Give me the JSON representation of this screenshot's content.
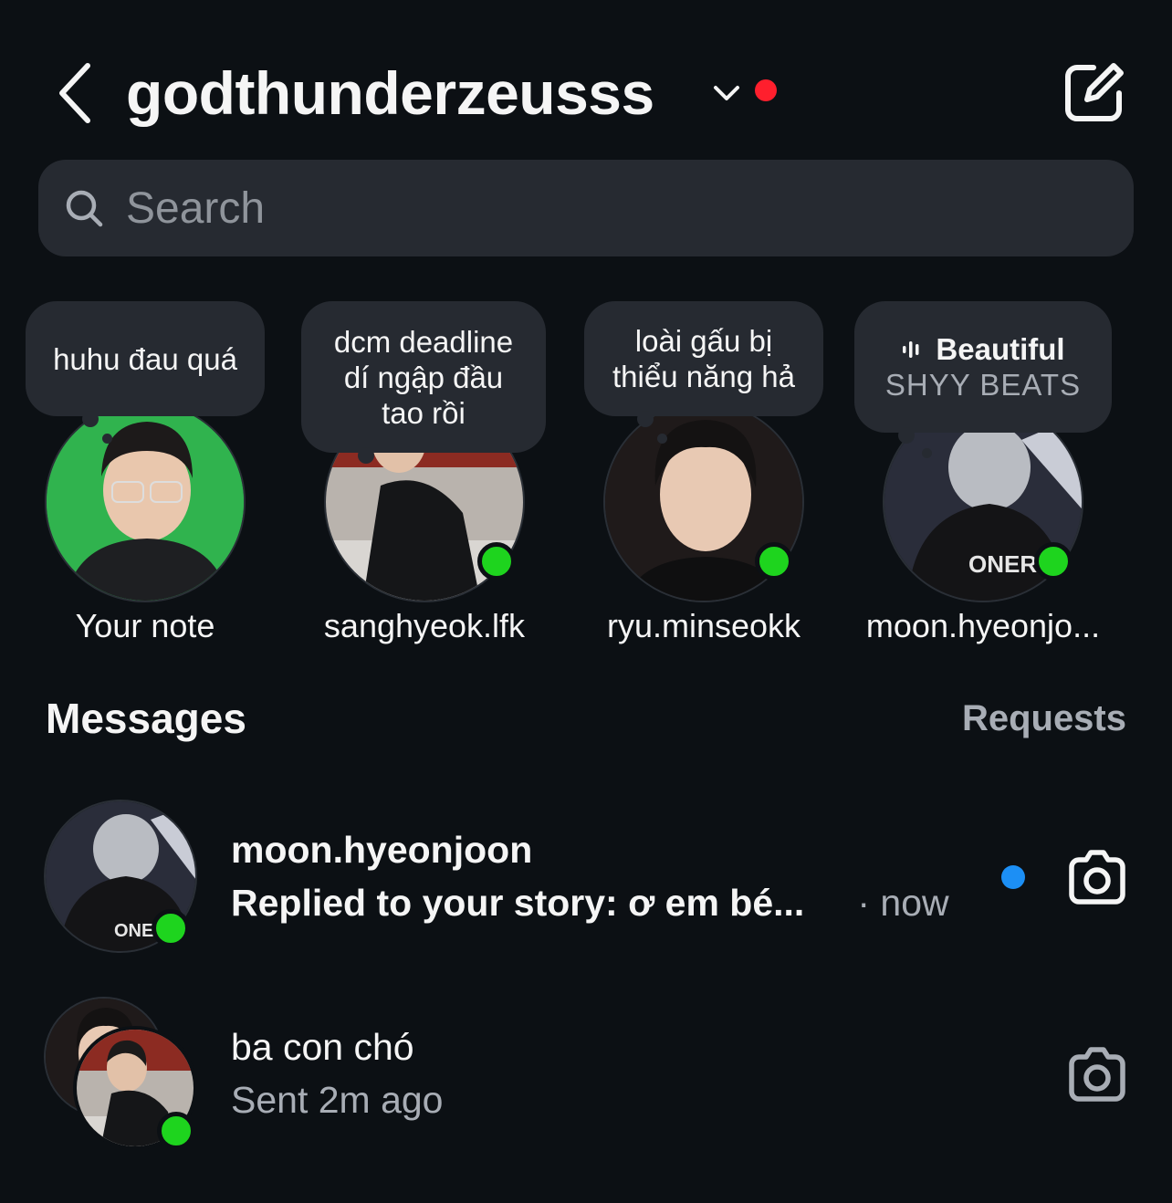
{
  "header": {
    "account_name": "godthunderzeusss",
    "has_unread_indicator": true
  },
  "search": {
    "placeholder": "Search"
  },
  "notes": [
    {
      "note_text_lines": [
        "huhu đau quá"
      ],
      "label": "Your note",
      "online": false
    },
    {
      "note_text_lines": [
        "dcm deadline",
        "dí ngập đầu",
        "tao rồi"
      ],
      "label": "sanghyeok.lfk",
      "online": true
    },
    {
      "note_text_lines": [
        "loài gấu bị",
        "thiểu năng hả"
      ],
      "label": "ryu.minseokk",
      "online": true
    },
    {
      "music_title": "Beautiful",
      "music_artist": "SHYY BEATS",
      "label": "moon.hyeonjo...",
      "online": true
    }
  ],
  "messages_section": {
    "heading": "Messages",
    "requests_label": "Requests"
  },
  "conversations": [
    {
      "name": "moon.hyeonjoon",
      "preview": "Replied to your story: ơ em bé...",
      "time": " · now",
      "unread": true,
      "online": true
    },
    {
      "name": "ba con chó",
      "preview": "Sent 2m ago",
      "time": "",
      "unread": false,
      "online": true
    }
  ],
  "colors": {
    "background": "#0c1014",
    "surface": "#262a31",
    "online": "#1ed41e",
    "unread": "#1c8ff5",
    "alert": "#ff1f2d"
  }
}
